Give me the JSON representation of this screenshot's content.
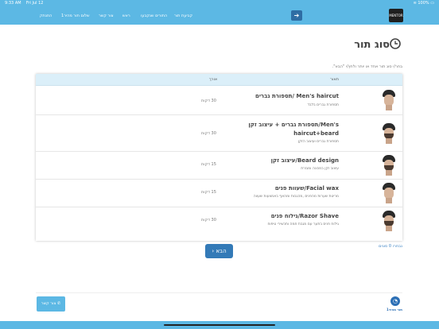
{
  "status_bar": {
    "time": "9:33 AM",
    "date": "Fri Jul 12",
    "battery": "100%",
    "wifi_icon": "wifi-icon",
    "battery_icon": "battery-icon"
  },
  "navbar": {
    "logo_text": "MENTOR",
    "login_icon": "login-arrow-icon",
    "links": [
      "קביעת תור",
      "התורים שנקבעו",
      "ראש",
      "צור קשר",
      "שלום תור מהיר1",
      "התנתק"
    ]
  },
  "page": {
    "title": "סוג תור",
    "title_icon": "clock-icon",
    "instruction": "בחר/י סוג תור אחד או יותר ולחץ/י \"הבא\"."
  },
  "table": {
    "headers": {
      "title": "תאור",
      "length": "אורך"
    },
    "rows": [
      {
        "name": "תספורת גברים/ Men's haircut",
        "description": "תספורת גברים בלבד",
        "length": "30 דקות"
      },
      {
        "name": "תספורת גברים + עיצוב זקן/Men's haircut+beard",
        "description": "תספורת גברים ועיצוב הזקן",
        "length": "30 דקות"
      },
      {
        "name": "עיצוב זקן/Beard design",
        "description": "עיצוב זקן במכונה ומגזרת",
        "length": "15 דקות"
      },
      {
        "name": "שעוות פנים/Facial wax",
        "description": "מריטת שערות מהפנים ,מהגבות ומהאף באמצעות שעווה",
        "length": "15 דקות"
      },
      {
        "name": "גילוח פנים/Razor Shave",
        "description": "גילוח פנים בתער עם מגבת חמה ותכשירי טיפוח",
        "length": "30 דקות"
      }
    ]
  },
  "footer_controls": {
    "selected_count": "נבחרו 0 סוגים",
    "next_label": "הבא",
    "next_icon": "chevron-left-icon",
    "contact_label": "צור קשר",
    "contact_icon": "phone-icon",
    "brand_text": "תור מהיר1",
    "brand_icon": "brand-logo-icon"
  },
  "colors": {
    "primary": "#5cb8e4",
    "button": "#337ab7",
    "table_header": "#dbeff9"
  }
}
